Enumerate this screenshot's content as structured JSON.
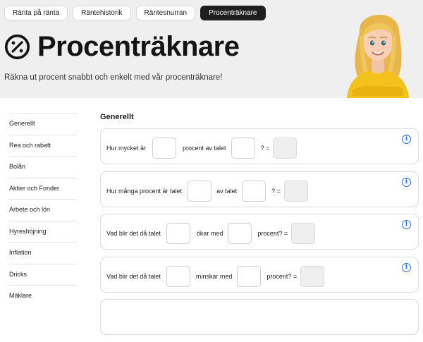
{
  "tabs": [
    {
      "label": "Ränta på ränta",
      "active": false
    },
    {
      "label": "Räntehistorik",
      "active": false
    },
    {
      "label": "Räntesnurran",
      "active": false
    },
    {
      "label": "Procenträknare",
      "active": true
    }
  ],
  "header": {
    "icon": "percent-circle-icon",
    "title": "Procenträknare",
    "subtitle": "Räkna ut procent snabbt och enkelt med vår procenträknare!"
  },
  "sidebar": {
    "items": [
      {
        "label": "Generellt"
      },
      {
        "label": "Rea och rabatt"
      },
      {
        "label": "Bolån"
      },
      {
        "label": "Aktier och Fonder"
      },
      {
        "label": "Arbete och lön"
      },
      {
        "label": "Hyreshöjning"
      },
      {
        "label": "Inflation"
      },
      {
        "label": "Dricks"
      },
      {
        "label": "Mäklare"
      }
    ]
  },
  "main": {
    "section_title": "Generellt",
    "cards": [
      {
        "part1": "Hur mycket är",
        "part2": "procent av talet",
        "part3": "? ="
      },
      {
        "part1": "Hur många procent är talet",
        "part2": "av talet",
        "part3": "? ="
      },
      {
        "part1": "Vad blir det då talet",
        "part2": "ökar med",
        "part3": "procent? ="
      },
      {
        "part1": "Vad blir det då talet",
        "part2": "minskar med",
        "part3": "procent? ="
      }
    ]
  },
  "colors": {
    "accent": "#2b6fd6",
    "active_tab": "#1f1f1f",
    "hero_bg": "#efefef"
  }
}
